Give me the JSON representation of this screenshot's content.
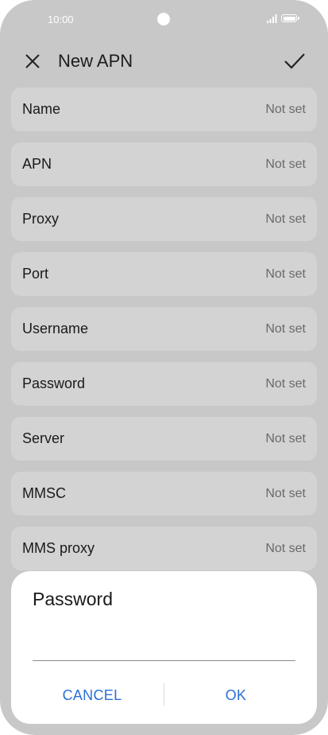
{
  "status_bar": {
    "time": "10:00",
    "icons": [
      "camera-icon",
      "signal-icon",
      "battery-icon"
    ]
  },
  "toolbar": {
    "title": "New APN",
    "close_icon": "close-icon",
    "confirm_icon": "check-icon"
  },
  "fields": [
    {
      "label": "Name",
      "value": "Not set"
    },
    {
      "label": "APN",
      "value": "Not set"
    },
    {
      "label": "Proxy",
      "value": "Not set"
    },
    {
      "label": "Port",
      "value": "Not set"
    },
    {
      "label": "Username",
      "value": "Not set"
    },
    {
      "label": "Password",
      "value": "Not set"
    },
    {
      "label": "Server",
      "value": "Not set"
    },
    {
      "label": "MMSC",
      "value": "Not set"
    },
    {
      "label": "MMS proxy",
      "value": "Not set"
    }
  ],
  "dialog": {
    "title": "Password",
    "input_value": "",
    "cancel_label": "CANCEL",
    "ok_label": "OK"
  },
  "colors": {
    "background": "#c8c8c8",
    "row_background": "#d3d3d3",
    "accent": "#2b6fd6"
  }
}
